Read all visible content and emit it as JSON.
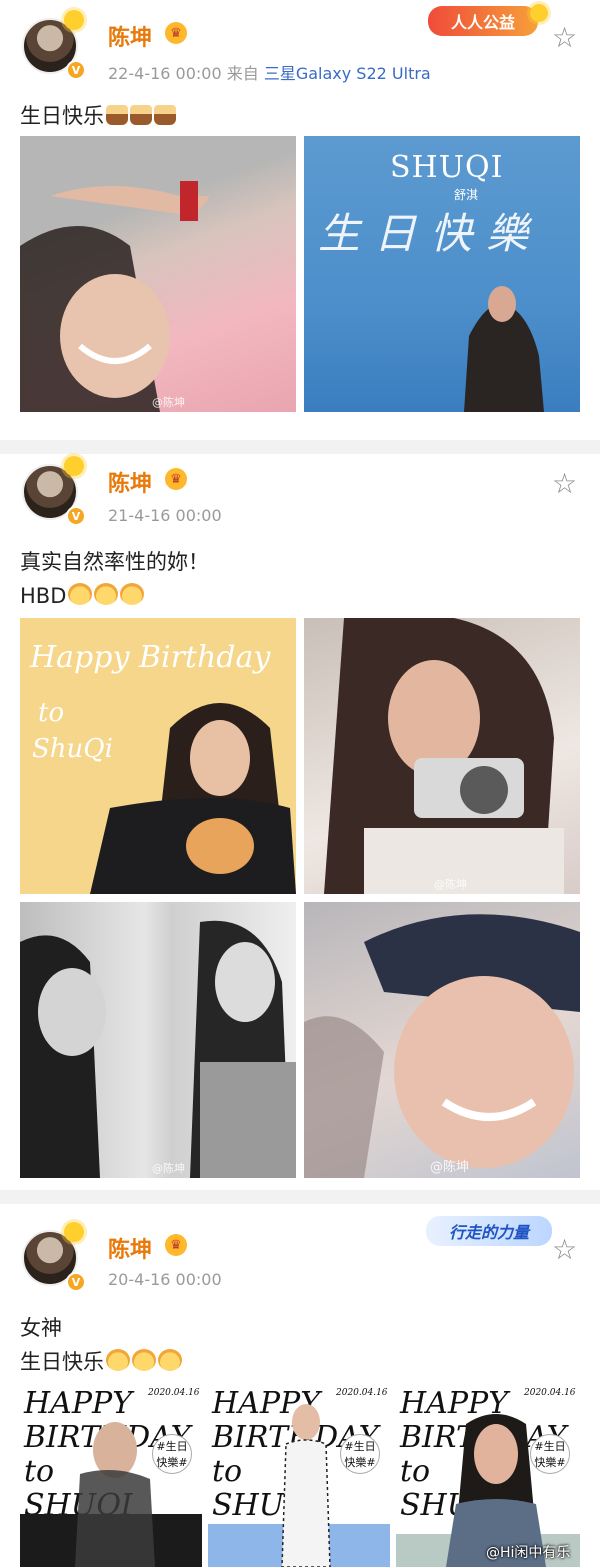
{
  "post1": {
    "username": "陈坤",
    "verify_mark": "V",
    "meta": "22-4-16 00:00  来自",
    "device": "三星Galaxy S22 Ultra",
    "badge": "人人公益",
    "text": "生日快乐",
    "images": [
      {
        "watermark": "@陈坤"
      },
      {
        "title": "SHUQI",
        "subtitle": "舒淇",
        "script": "生日快樂"
      }
    ]
  },
  "post2": {
    "username": "陈坤",
    "verify_mark": "V",
    "meta": "21-4-16 00:00",
    "text_line1": "真实自然率性的妳！",
    "text_line2": "HBD",
    "images": [
      {
        "script1": "Happy Birthday",
        "script2": "to",
        "script3": "ShuQi"
      },
      {
        "watermark": "@陈坤"
      },
      {
        "watermark": "@陈坤"
      },
      {
        "watermark": "@陈坤"
      }
    ]
  },
  "post3": {
    "username": "陈坤",
    "verify_mark": "V",
    "meta": "20-4-16 00:00",
    "badge": "行走的力量",
    "text_line1": "女神",
    "text_line2": "生日快乐",
    "images": [
      {
        "line1": "HAPPY",
        "line2": "BIRTHDAY",
        "line3": "to",
        "line4": "SHUQI",
        "date": "2020.04.16",
        "tag": "#生日快樂#"
      },
      {
        "line1": "HAPPY",
        "line2": "BIRTHDAY",
        "line3": "to",
        "line4": "SHUQI",
        "date": "2020.04.16",
        "tag": "#生日快樂#"
      },
      {
        "line1": "HAPPY",
        "line2": "BIRTHDAY",
        "line3": "to",
        "line4": "SHUQI",
        "date": "2020.04.16",
        "tag": "#生日快樂#"
      }
    ]
  },
  "footer_watermark": "@Hi闲中有乐"
}
